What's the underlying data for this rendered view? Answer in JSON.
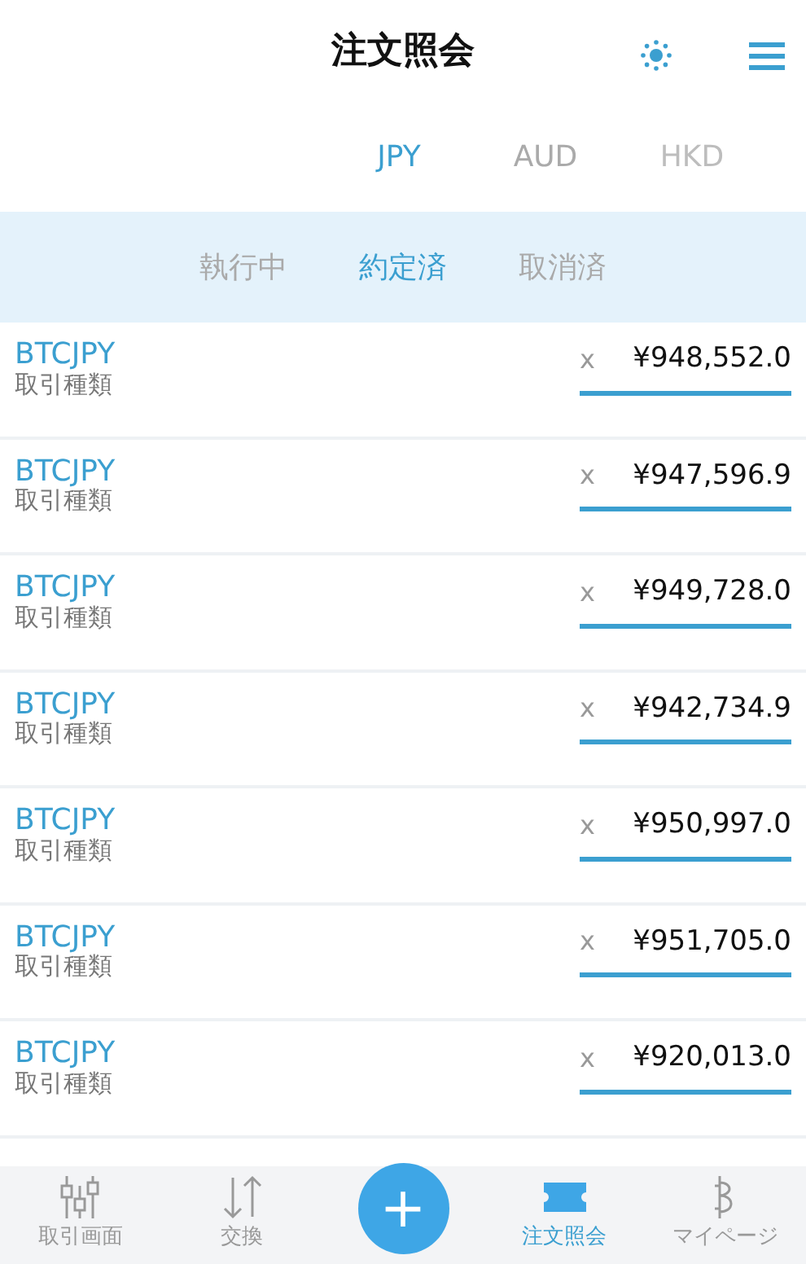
{
  "header": {
    "title": "注文照会"
  },
  "currency_tabs": [
    {
      "label": "JPY",
      "selected": true,
      "disabled": false
    },
    {
      "label": "AUD",
      "selected": false,
      "disabled": false
    },
    {
      "label": "HKD",
      "selected": false,
      "disabled": true
    }
  ],
  "status_tabs": [
    {
      "label": "執行中",
      "selected": false
    },
    {
      "label": "約定済",
      "selected": true
    },
    {
      "label": "取消済",
      "selected": false
    }
  ],
  "orders": [
    {
      "symbol": "BTCJPY",
      "type": "取引種類",
      "cancel": "x",
      "price": "¥948,552.0"
    },
    {
      "symbol": "BTCJPY",
      "type": "取引種類",
      "cancel": "x",
      "price": "¥947,596.9"
    },
    {
      "symbol": "BTCJPY",
      "type": "取引種類",
      "cancel": "x",
      "price": "¥949,728.0"
    },
    {
      "symbol": "BTCJPY",
      "type": "取引種類",
      "cancel": "x",
      "price": "¥942,734.9"
    },
    {
      "symbol": "BTCJPY",
      "type": "取引種類",
      "cancel": "x",
      "price": "¥950,997.0"
    },
    {
      "symbol": "BTCJPY",
      "type": "取引種類",
      "cancel": "x",
      "price": "¥951,705.0"
    },
    {
      "symbol": "BTCJPY",
      "type": "取引種類",
      "cancel": "x",
      "price": "¥920,013.0"
    }
  ],
  "bottom_nav": [
    {
      "kind": "chart",
      "label": "取引画面",
      "selected": false
    },
    {
      "kind": "exchange",
      "label": "交換",
      "selected": false
    },
    {
      "kind": "add",
      "label": "+",
      "selected": false
    },
    {
      "kind": "ticket",
      "label": "注文照会",
      "selected": true
    },
    {
      "kind": "wallet",
      "label": "マイページ",
      "selected": false
    }
  ]
}
